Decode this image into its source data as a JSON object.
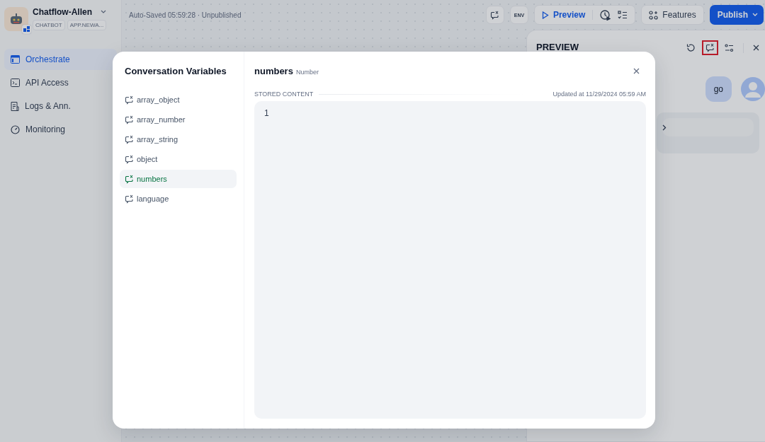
{
  "app": {
    "name": "Chatflow-Allen",
    "tags": [
      "CHATBOT",
      "APP.NEWA..."
    ]
  },
  "nav": [
    {
      "label": "Orchestrate",
      "kind": "orchestrate",
      "selected": true
    },
    {
      "label": "API Access",
      "kind": "api",
      "selected": false
    },
    {
      "label": "Logs & Ann.",
      "kind": "logs",
      "selected": false
    },
    {
      "label": "Monitoring",
      "kind": "monitoring",
      "selected": false
    }
  ],
  "header": {
    "status": "Auto-Saved 05:59:28 · Unpublished",
    "env": "ENV",
    "preview": "Preview",
    "features": "Features",
    "publish": "Publish"
  },
  "preview": {
    "title": "PREVIEW",
    "variables_highlighted": true,
    "message": "go"
  },
  "modal": {
    "title": "Conversation Variables",
    "variables": [
      {
        "name": "array_object",
        "selected": false
      },
      {
        "name": "array_number",
        "selected": false
      },
      {
        "name": "array_string",
        "selected": false
      },
      {
        "name": "object",
        "selected": false
      },
      {
        "name": "numbers",
        "selected": true
      },
      {
        "name": "language",
        "selected": false
      }
    ],
    "detail": {
      "name": "numbers",
      "type": "Number",
      "section": "STORED CONTENT",
      "updated": "Updated at 11/29/2024 05:59 AM",
      "content": "1"
    }
  }
}
